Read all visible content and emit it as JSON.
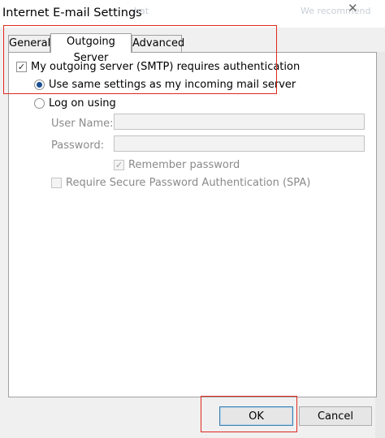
{
  "window": {
    "title": "Internet E-mail Settings"
  },
  "background_text": [
    "We recommend",
    "hat"
  ],
  "tabs": [
    {
      "label": "General"
    },
    {
      "label": "Outgoing Server"
    },
    {
      "label": "Advanced"
    }
  ],
  "outgoing": {
    "smtp_auth": {
      "label": "My outgoing server (SMTP) requires authentication",
      "checked": true
    },
    "use_same": {
      "label": "Use same settings as my incoming mail server",
      "selected": true
    },
    "log_on": {
      "label": "Log on using",
      "selected": false
    },
    "username": {
      "label": "User Name:",
      "value": ""
    },
    "password": {
      "label": "Password:",
      "value": ""
    },
    "remember": {
      "label": "Remember password",
      "checked": true,
      "enabled": false
    },
    "spa": {
      "label": "Require Secure Password Authentication (SPA)",
      "checked": false,
      "enabled": false
    }
  },
  "buttons": {
    "ok": "OK",
    "cancel": "Cancel"
  },
  "colors": {
    "highlight_box": "#e0291f",
    "radio_dot": "#1b4f93"
  }
}
